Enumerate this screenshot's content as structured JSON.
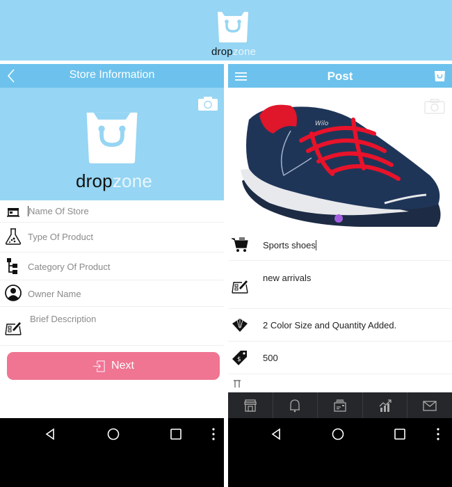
{
  "brand": {
    "logo_part1": "drop",
    "logo_part2": "zone",
    "primary_color": "#6cc2ec",
    "light_color": "#96d5f3",
    "accent_color": "#ef7592"
  },
  "store_screen": {
    "title": "Store Information",
    "fields": [
      {
        "icon": "store-icon",
        "placeholder": "Name Of Store"
      },
      {
        "icon": "flask-icon",
        "placeholder": "Type Of Product"
      },
      {
        "icon": "hierarchy-icon",
        "placeholder": "Category Of Product"
      },
      {
        "icon": "user-icon",
        "placeholder": "Owner Name"
      },
      {
        "icon": "edit-form-icon",
        "placeholder": "Brief Description"
      }
    ],
    "next_label": "Next"
  },
  "post_screen": {
    "title": "Post",
    "fields": [
      {
        "icon": "cart-icon",
        "value": "Sports shoes"
      },
      {
        "icon": "edit-form-icon",
        "value": "new arrivals"
      },
      {
        "icon": "color-swatch-icon",
        "value": "2 Color Size and Quantity Added."
      },
      {
        "icon": "price-tag-icon",
        "value": "500"
      },
      {
        "icon": "size-icon",
        "value": ""
      }
    ],
    "bottom_tabs": [
      "store-icon",
      "bell-icon",
      "wallet-icon",
      "chart-icon",
      "mail-icon"
    ]
  },
  "navbar": [
    "back",
    "home",
    "recents",
    "more"
  ]
}
